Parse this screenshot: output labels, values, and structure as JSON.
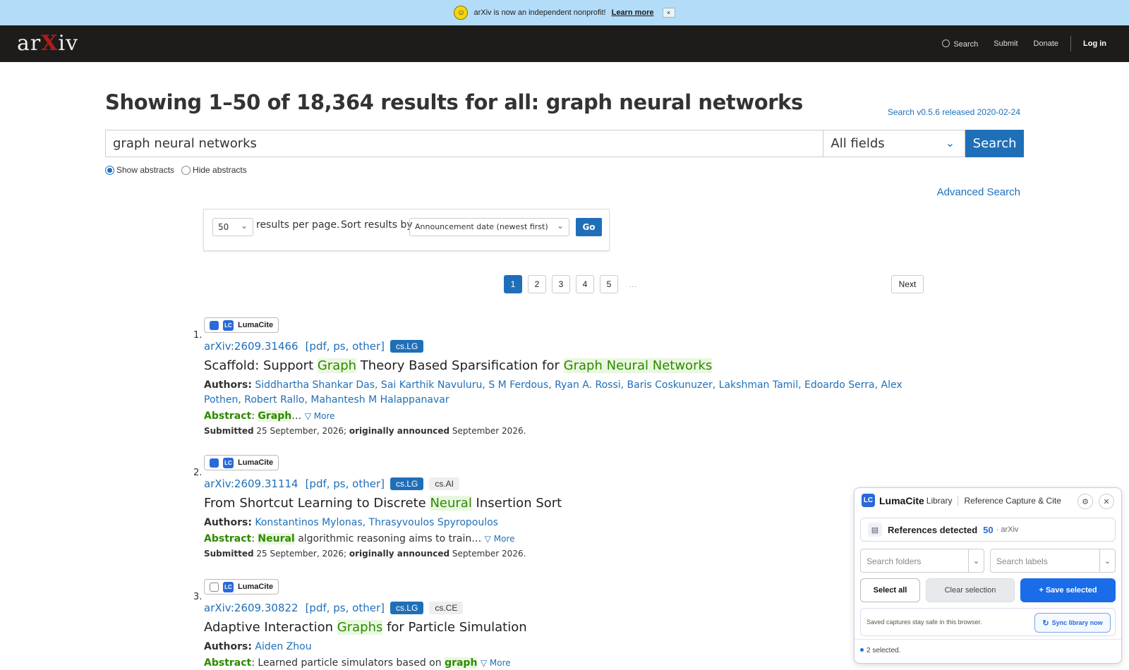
{
  "banner": {
    "text": "arXiv is now an independent nonprofit!",
    "link": "Learn more",
    "close": "×"
  },
  "header": {
    "logo": {
      "pre": "ar",
      "x": "X",
      "post": "iv"
    },
    "nav": {
      "search": "Search",
      "submit": "Submit",
      "donate": "Donate",
      "login": "Log in"
    }
  },
  "page": {
    "title": "Showing 1–50 of 18,364 results for all: graph neural networks",
    "version": "Search v0.5.6 released 2020-02-24",
    "search_value": "graph neural networks",
    "field": "All fields",
    "search_button": "Search",
    "show_abstracts": "Show abstracts",
    "hide_abstracts": "Hide abstracts",
    "advanced": "Advanced Search"
  },
  "sort": {
    "per_page": "50",
    "per_page_label": "results per page.",
    "sort_label": "Sort results by",
    "order": "Announcement date (newest first)",
    "go": "Go"
  },
  "pagination": {
    "pages": [
      "1",
      "2",
      "3",
      "4",
      "5"
    ],
    "ellipsis": "…",
    "next": "Next"
  },
  "results": [
    {
      "num": "1.",
      "badge": "LumaCite",
      "checked": true,
      "id": "arXiv:2609.31466",
      "links": "[pdf, ps, other]",
      "primary": "cs.LG",
      "secondary": "",
      "title_parts": [
        "Scaffold: Support ",
        "Graph",
        " Theory Based Sparsification for ",
        "Graph",
        " ",
        "Neural",
        " ",
        "Networks"
      ],
      "authors": "Siddhartha Shankar Das, Sai Karthik Navuluru, S M Ferdous, Ryan A. Rossi, Baris Coskunuzer, Lakshman Tamil, Edoardo Serra, Alex Pothen, Robert Rallo, Mahantesh M Halappanavar",
      "abstract_hl": "Graph",
      "abstract_rest": "…",
      "more": "▽ More",
      "submitted": "25 September, 2026;",
      "announced": "September 2026."
    },
    {
      "num": "2.",
      "badge": "LumaCite",
      "checked": true,
      "id": "arXiv:2609.31114",
      "links": "[pdf, ps, other]",
      "primary": "cs.LG",
      "secondary": "cs.AI",
      "title_parts": [
        "From Shortcut Learning to Discrete ",
        "Neural",
        " Insertion Sort"
      ],
      "authors": "Konstantinos Mylonas, Thrasyvoulos Spyropoulos",
      "abstract_hl": "Neural",
      "abstract_rest": " algorithmic reasoning aims to train…",
      "more": "▽ More",
      "submitted": "25 September, 2026;",
      "announced": "September 2026."
    },
    {
      "num": "3.",
      "badge": "LumaCite",
      "checked": false,
      "id": "arXiv:2609.30822",
      "links": "[pdf, ps, other]",
      "primary": "cs.LG",
      "secondary": "cs.CE",
      "title_parts": [
        "Adaptive Interaction ",
        "Graphs",
        " for Particle Simulation"
      ],
      "authors": "Aiden Zhou",
      "abstract_pre": "Learned particle simulators based on ",
      "abstract_hl": "graph",
      "more": "▽ More"
    }
  ],
  "labels": {
    "authors": "Authors:",
    "abstract": "Abstract",
    "submitted": "Submitted",
    "announced": "originally announced"
  },
  "panel": {
    "badge": "LC",
    "brand": "LumaCite",
    "library": "Library",
    "subtitle": "Reference Capture & Cite",
    "refs_label": "References detected",
    "refs_count": "50",
    "refs_source": "· arXiv",
    "folders_placeholder": "Search folders",
    "labels_placeholder": "Search labels",
    "select_all": "Select all",
    "clear": "Clear selection",
    "save": "+ Save selected",
    "note": "Saved captures stay safe in this browser.",
    "sync": "Sync library now",
    "status": "2 selected."
  }
}
